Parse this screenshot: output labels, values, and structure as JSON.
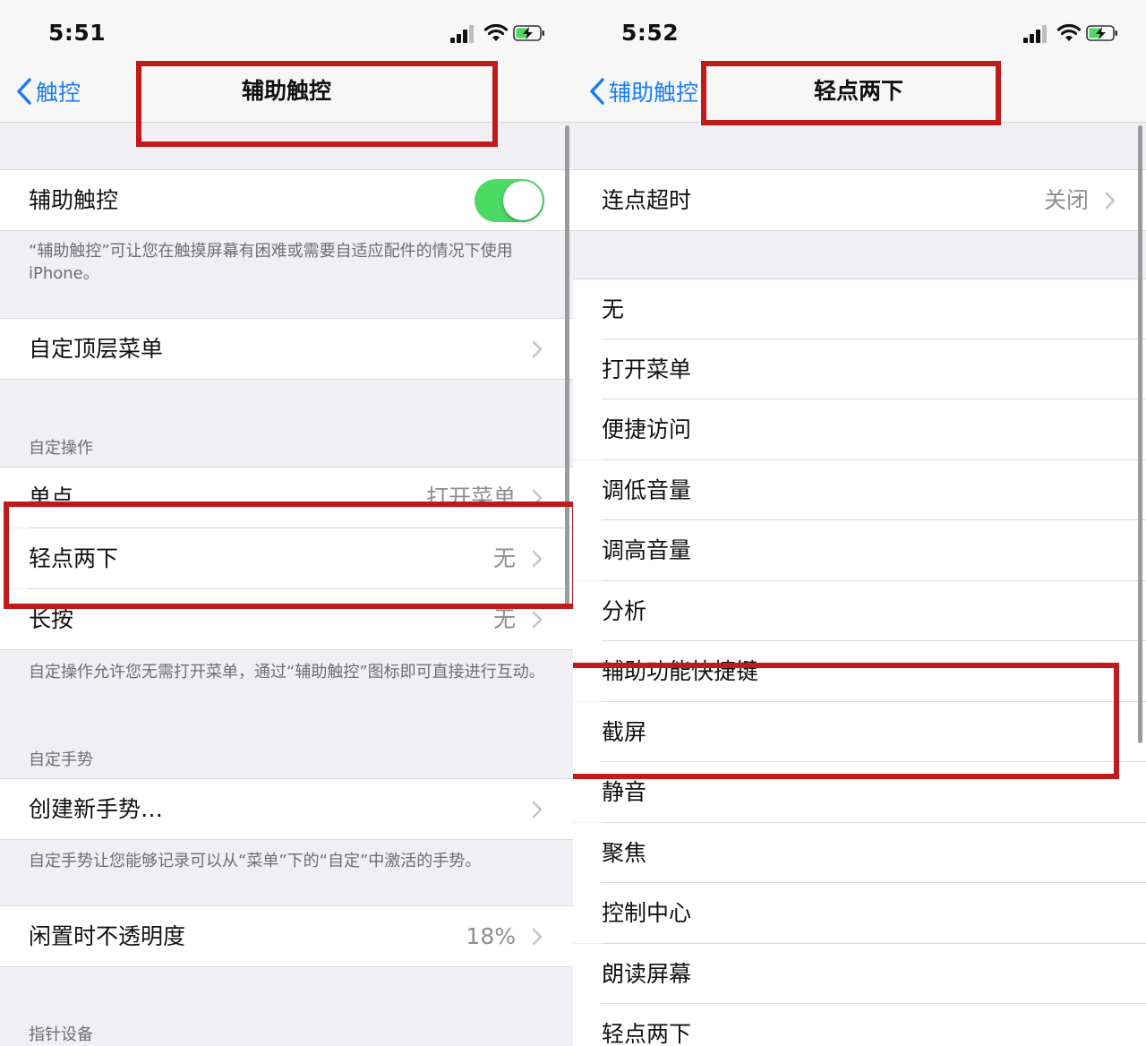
{
  "colors": {
    "ios_blue": "#1a7cf5",
    "switch_green": "#4cd964",
    "highlight_red": "#c01a1a"
  },
  "left": {
    "status": {
      "time": "5:51"
    },
    "nav": {
      "back_label": "触控",
      "title": "辅助触控"
    },
    "assistive_touch": {
      "label": "辅助触控",
      "switch_on": true
    },
    "assistive_touch_footer": "“辅助触控”可让您在触摸屏幕有困难或需要自适应配件的情况下使用iPhone。",
    "customize_menu": {
      "label": "自定顶层菜单"
    },
    "custom_actions": {
      "header": "自定操作",
      "rows": [
        {
          "label": "单点",
          "value": "打开菜单"
        },
        {
          "label": "轻点两下",
          "value": "无"
        },
        {
          "label": "长按",
          "value": "无"
        }
      ],
      "footer": "自定操作允许您无需打开菜单，通过“辅助触控”图标即可直接进行互动。"
    },
    "custom_gestures": {
      "header": "自定手势",
      "create_label": "创建新手势…",
      "footer": "自定手势让您能够记录可以从“菜单”下的“自定”中激活的手势。"
    },
    "idle_opacity": {
      "label": "闲置时不透明度",
      "value": "18%"
    },
    "pointer_header": "指针设备"
  },
  "right": {
    "status": {
      "time": "5:52"
    },
    "nav": {
      "back_label": "辅助触控",
      "title": "轻点两下"
    },
    "timeout": {
      "label": "连点超时",
      "value": "关闭"
    },
    "actions": [
      "无",
      "打开菜单",
      "便捷访问",
      "调低音量",
      "调高音量",
      "分析",
      "辅助功能快捷键",
      "截屏",
      "静音",
      "聚焦",
      "控制中心",
      "朗读屏幕",
      "轻点两下"
    ]
  }
}
